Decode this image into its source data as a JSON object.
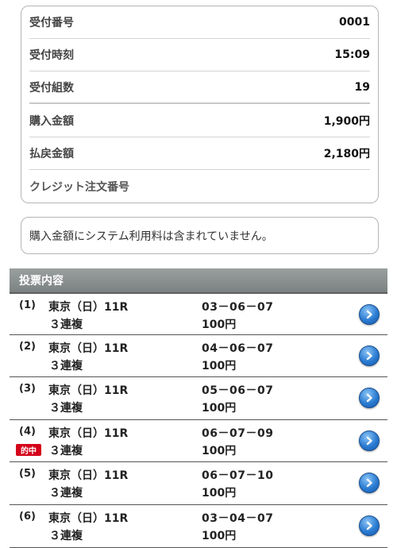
{
  "summary": {
    "reception_no_label": "受付番号",
    "reception_no_value": "0001",
    "reception_time_label": "受付時刻",
    "reception_time_value": "15:09",
    "group_count_label": "受付組数",
    "group_count_value": "19",
    "purchase_amount_label": "購入金額",
    "purchase_amount_value": "1,900円",
    "payout_amount_label": "払戻金額",
    "payout_amount_value": "2,180円",
    "credit_order_label": "クレジット注文番号",
    "credit_order_value": ""
  },
  "notice": {
    "text": "購入金額にシステム利用料は含まれていません。"
  },
  "bets_section": {
    "title": "投票内容",
    "hit_badge_label": "的中",
    "items": [
      {
        "num": "(1)",
        "race": "東京（日）11R",
        "type": "３連複",
        "combo": "03－06－07",
        "amount": "100円",
        "hit": false
      },
      {
        "num": "(2)",
        "race": "東京（日）11R",
        "type": "３連複",
        "combo": "04－06－07",
        "amount": "100円",
        "hit": false
      },
      {
        "num": "(3)",
        "race": "東京（日）11R",
        "type": "３連複",
        "combo": "05－06－07",
        "amount": "100円",
        "hit": false
      },
      {
        "num": "(4)",
        "race": "東京（日）11R",
        "type": "３連複",
        "combo": "06－07－09",
        "amount": "100円",
        "hit": true
      },
      {
        "num": "(5)",
        "race": "東京（日）11R",
        "type": "３連複",
        "combo": "06－07－10",
        "amount": "100円",
        "hit": false
      },
      {
        "num": "(6)",
        "race": "東京（日）11R",
        "type": "３連複",
        "combo": "03－04－07",
        "amount": "100円",
        "hit": false
      }
    ]
  },
  "icons": {
    "row_button": "chevron-right-circle-icon"
  },
  "colors": {
    "header_bg": "#858b8a",
    "hit_badge": "#d4001a",
    "button_blue": "#2a7bd2"
  }
}
